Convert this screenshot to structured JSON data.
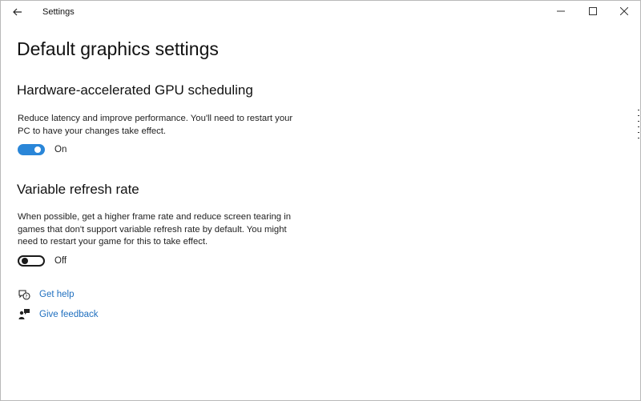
{
  "window": {
    "app_title": "Settings"
  },
  "page": {
    "title": "Default graphics settings"
  },
  "gpu_scheduling": {
    "title": "Hardware-accelerated GPU scheduling",
    "description": "Reduce latency and improve performance. You'll need to restart your PC to have your changes take effect.",
    "toggle_state": "on",
    "toggle_label": "On"
  },
  "vrr": {
    "title": "Variable refresh rate",
    "description": "When possible, get a higher frame rate and reduce screen tearing in games that don't support variable refresh rate by default. You might need to restart your game for this to take effect.",
    "toggle_state": "off",
    "toggle_label": "Off"
  },
  "links": {
    "help_label": "Get help",
    "help_icon": "help-chat-icon",
    "feedback_label": "Give feedback",
    "feedback_icon": "feedback-person-icon"
  },
  "colors": {
    "accent": "#2a86d8",
    "link": "#1f6fbf"
  }
}
